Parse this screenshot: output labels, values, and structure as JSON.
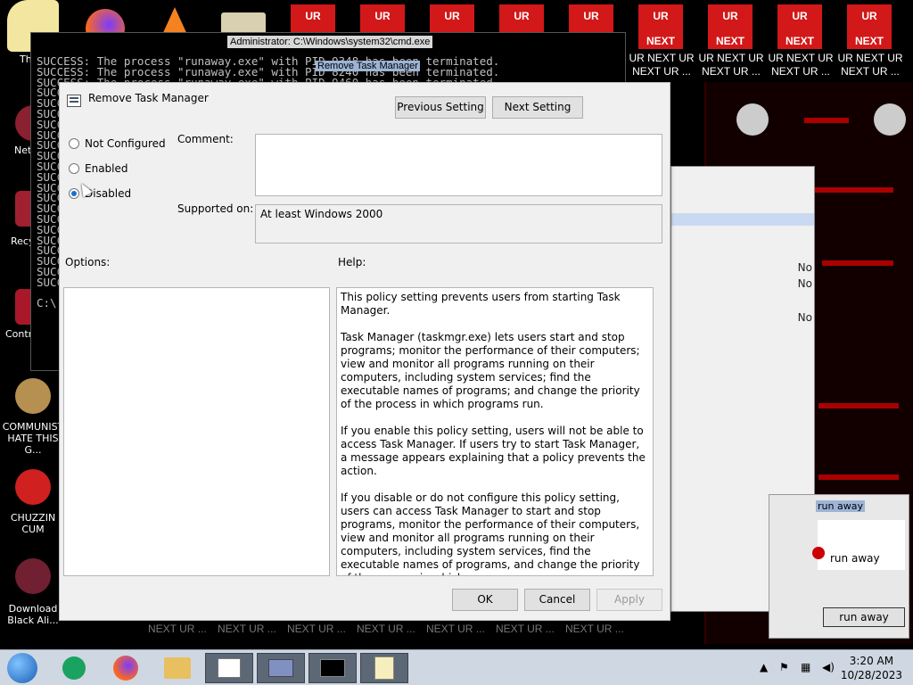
{
  "desktop": {
    "cmd_title": "Administrator: C:\\Windows\\system32\\cmd.exe",
    "cmd_lines": [
      "SUCCESS: The process \"runaway.exe\" with PID 9348 has been terminated.",
      "SUCCESS: The process \"runaway.exe\" with PID 8240 has been terminated.",
      "SUCCESS: The process \"runaway.exe\" with PID 9460 has been terminated.",
      "SUCC",
      "SUCC",
      "SUCC",
      "SUCC",
      "SUCC",
      "SUCC",
      "SUCC",
      "SUCC",
      "SUCC",
      "SUCC",
      "SUCC",
      "SUCC",
      "SUCC",
      "SUCC",
      "SUCC",
      "SUCC",
      "SUCC",
      "SUCC",
      "SUCC",
      "",
      "C:\\"
    ],
    "cmd_tooltip": "Remove Task Manager",
    "icons": {
      "this_pc": "This",
      "network": "Netw",
      "recycle": "Recyc",
      "control_panel": "Control Panel",
      "communist": "COMMUNIST HATE THIS G...",
      "chuzzin": "CHUZZIN CUM",
      "black_ali": "Download Black Ali..."
    },
    "ur_tile_top": "UR",
    "ur_tile_bottom": "NEXT",
    "ur_caption_1": "UR NEXT UR",
    "ur_caption_2": "NEXT UR ...",
    "next_ur_bottom": "NEXT UR ...",
    "behind_window_labels": [
      "No",
      "No",
      "No"
    ],
    "runaway": {
      "title": "run away",
      "message": "run away",
      "button": "run away"
    }
  },
  "dialog": {
    "title": "Remove Task Manager",
    "prev_button": "Previous Setting",
    "next_button": "Next Setting",
    "options": [
      {
        "label": "Not Configured",
        "selected": false
      },
      {
        "label": "Enabled",
        "selected": false
      },
      {
        "label": "Disabled",
        "selected": true
      }
    ],
    "comment_label": "Comment:",
    "comment_value": "",
    "supported_label": "Supported on:",
    "supported_value": "At least Windows 2000",
    "options_label": "Options:",
    "help_label": "Help:",
    "help_paragraphs": [
      "This policy setting prevents users from starting Task Manager.",
      "Task Manager (taskmgr.exe) lets users start and stop programs; monitor the performance of their computers; view and monitor all programs running on their computers, including system services; find the executable names of programs; and change the priority of the process in which programs run.",
      "If you enable this policy setting, users will not be able to access Task Manager. If users try to start Task Manager, a message appears explaining that a policy prevents the action.",
      "If you disable or do not configure this policy setting, users can access Task Manager to  start and stop programs, monitor the performance of their computers, view and monitor all programs running on their computers, including system services, find the executable names of programs, and change the priority of the process in which programs run."
    ],
    "ok_button": "OK",
    "cancel_button": "Cancel",
    "apply_button": "Apply"
  },
  "taskbar": {
    "time": "3:20 AM",
    "date": "10/28/2023"
  },
  "colors": {
    "ur_red": "#d21818",
    "radio_blue": "#1a6fd3",
    "taskbar": "#cfd7e2"
  }
}
